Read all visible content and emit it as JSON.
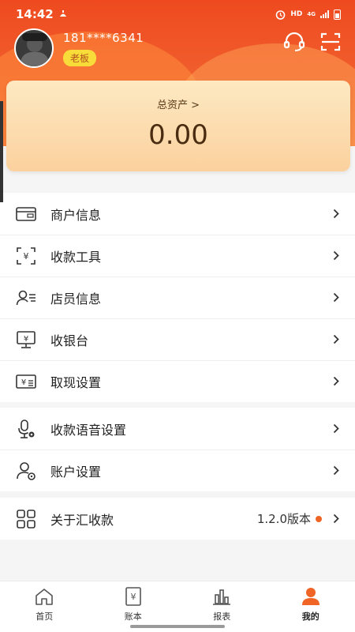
{
  "status_bar": {
    "time": "14:42",
    "network": "HD",
    "signal": "4G"
  },
  "profile": {
    "phone": "181****6341",
    "role": "老板"
  },
  "header_icons": [
    "headset-icon",
    "scan-icon"
  ],
  "asset": {
    "label": "总资产 >",
    "value": "0.00"
  },
  "menu_group_1": [
    {
      "label": "商户信息",
      "icon": "merchant-card-icon"
    },
    {
      "label": "收款工具",
      "icon": "payment-scan-icon"
    },
    {
      "label": "店员信息",
      "icon": "staff-icon"
    },
    {
      "label": "收银台",
      "icon": "cashier-monitor-icon"
    },
    {
      "label": "取现设置",
      "icon": "withdraw-icon"
    }
  ],
  "menu_group_2": [
    {
      "label": "收款语音设置",
      "icon": "voice-settings-icon"
    },
    {
      "label": "账户设置",
      "icon": "account-settings-icon"
    }
  ],
  "menu_group_3": [
    {
      "label": "关于汇收款",
      "icon": "grid-apps-icon",
      "version": "1.2.0版本"
    }
  ],
  "bottom_nav": [
    {
      "label": "首页",
      "icon": "home-icon",
      "active": false
    },
    {
      "label": "账本",
      "icon": "ledger-icon",
      "active": false
    },
    {
      "label": "报表",
      "icon": "report-icon",
      "active": false
    },
    {
      "label": "我的",
      "icon": "profile-icon",
      "active": true
    }
  ],
  "colors": {
    "accent": "#f06426",
    "header": "#ef4a1f",
    "badge": "#f8dd3a"
  }
}
